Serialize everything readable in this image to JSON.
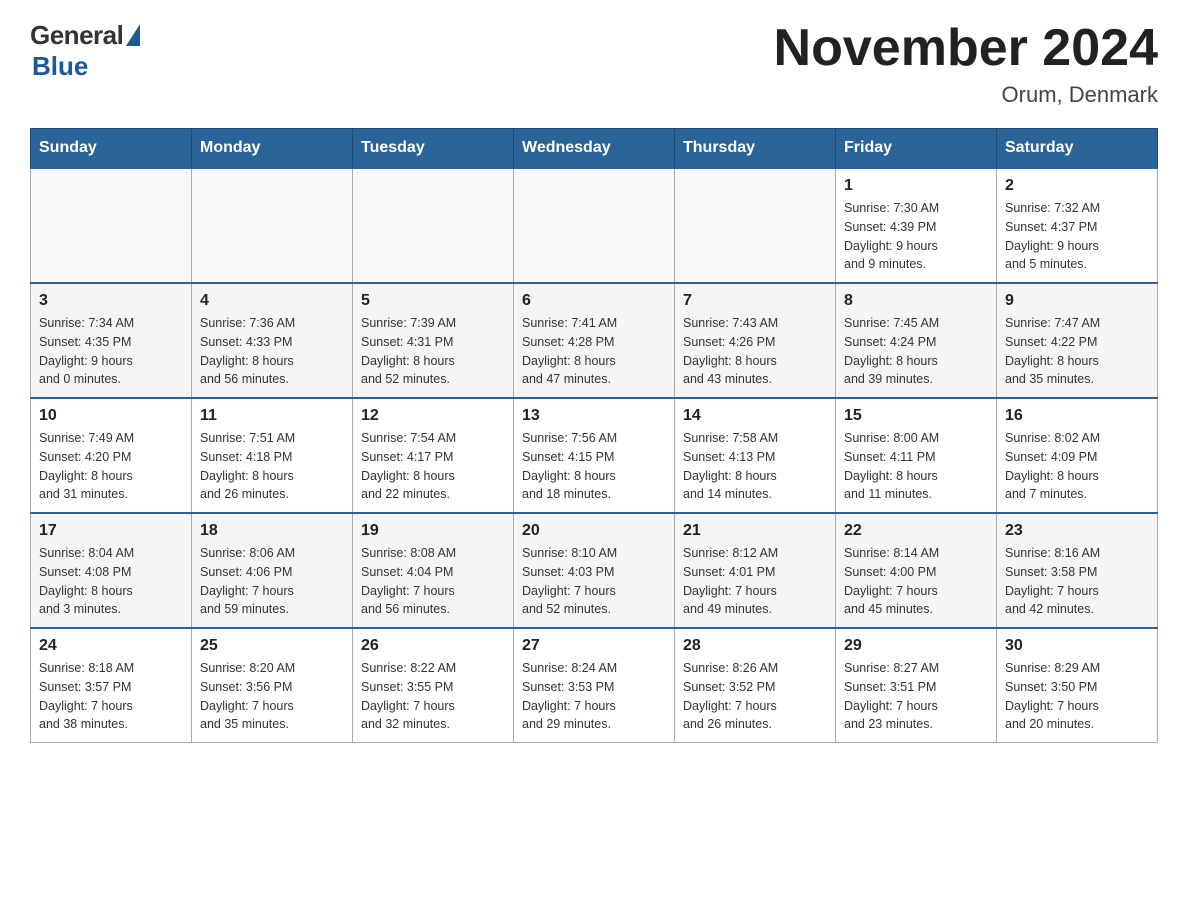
{
  "header": {
    "logo": {
      "general": "General",
      "blue": "Blue"
    },
    "title": "November 2024",
    "location": "Orum, Denmark"
  },
  "weekdays": [
    "Sunday",
    "Monday",
    "Tuesday",
    "Wednesday",
    "Thursday",
    "Friday",
    "Saturday"
  ],
  "weeks": [
    {
      "days": [
        {
          "num": "",
          "info": ""
        },
        {
          "num": "",
          "info": ""
        },
        {
          "num": "",
          "info": ""
        },
        {
          "num": "",
          "info": ""
        },
        {
          "num": "",
          "info": ""
        },
        {
          "num": "1",
          "info": "Sunrise: 7:30 AM\nSunset: 4:39 PM\nDaylight: 9 hours\nand 9 minutes."
        },
        {
          "num": "2",
          "info": "Sunrise: 7:32 AM\nSunset: 4:37 PM\nDaylight: 9 hours\nand 5 minutes."
        }
      ]
    },
    {
      "days": [
        {
          "num": "3",
          "info": "Sunrise: 7:34 AM\nSunset: 4:35 PM\nDaylight: 9 hours\nand 0 minutes."
        },
        {
          "num": "4",
          "info": "Sunrise: 7:36 AM\nSunset: 4:33 PM\nDaylight: 8 hours\nand 56 minutes."
        },
        {
          "num": "5",
          "info": "Sunrise: 7:39 AM\nSunset: 4:31 PM\nDaylight: 8 hours\nand 52 minutes."
        },
        {
          "num": "6",
          "info": "Sunrise: 7:41 AM\nSunset: 4:28 PM\nDaylight: 8 hours\nand 47 minutes."
        },
        {
          "num": "7",
          "info": "Sunrise: 7:43 AM\nSunset: 4:26 PM\nDaylight: 8 hours\nand 43 minutes."
        },
        {
          "num": "8",
          "info": "Sunrise: 7:45 AM\nSunset: 4:24 PM\nDaylight: 8 hours\nand 39 minutes."
        },
        {
          "num": "9",
          "info": "Sunrise: 7:47 AM\nSunset: 4:22 PM\nDaylight: 8 hours\nand 35 minutes."
        }
      ]
    },
    {
      "days": [
        {
          "num": "10",
          "info": "Sunrise: 7:49 AM\nSunset: 4:20 PM\nDaylight: 8 hours\nand 31 minutes."
        },
        {
          "num": "11",
          "info": "Sunrise: 7:51 AM\nSunset: 4:18 PM\nDaylight: 8 hours\nand 26 minutes."
        },
        {
          "num": "12",
          "info": "Sunrise: 7:54 AM\nSunset: 4:17 PM\nDaylight: 8 hours\nand 22 minutes."
        },
        {
          "num": "13",
          "info": "Sunrise: 7:56 AM\nSunset: 4:15 PM\nDaylight: 8 hours\nand 18 minutes."
        },
        {
          "num": "14",
          "info": "Sunrise: 7:58 AM\nSunset: 4:13 PM\nDaylight: 8 hours\nand 14 minutes."
        },
        {
          "num": "15",
          "info": "Sunrise: 8:00 AM\nSunset: 4:11 PM\nDaylight: 8 hours\nand 11 minutes."
        },
        {
          "num": "16",
          "info": "Sunrise: 8:02 AM\nSunset: 4:09 PM\nDaylight: 8 hours\nand 7 minutes."
        }
      ]
    },
    {
      "days": [
        {
          "num": "17",
          "info": "Sunrise: 8:04 AM\nSunset: 4:08 PM\nDaylight: 8 hours\nand 3 minutes."
        },
        {
          "num": "18",
          "info": "Sunrise: 8:06 AM\nSunset: 4:06 PM\nDaylight: 7 hours\nand 59 minutes."
        },
        {
          "num": "19",
          "info": "Sunrise: 8:08 AM\nSunset: 4:04 PM\nDaylight: 7 hours\nand 56 minutes."
        },
        {
          "num": "20",
          "info": "Sunrise: 8:10 AM\nSunset: 4:03 PM\nDaylight: 7 hours\nand 52 minutes."
        },
        {
          "num": "21",
          "info": "Sunrise: 8:12 AM\nSunset: 4:01 PM\nDaylight: 7 hours\nand 49 minutes."
        },
        {
          "num": "22",
          "info": "Sunrise: 8:14 AM\nSunset: 4:00 PM\nDaylight: 7 hours\nand 45 minutes."
        },
        {
          "num": "23",
          "info": "Sunrise: 8:16 AM\nSunset: 3:58 PM\nDaylight: 7 hours\nand 42 minutes."
        }
      ]
    },
    {
      "days": [
        {
          "num": "24",
          "info": "Sunrise: 8:18 AM\nSunset: 3:57 PM\nDaylight: 7 hours\nand 38 minutes."
        },
        {
          "num": "25",
          "info": "Sunrise: 8:20 AM\nSunset: 3:56 PM\nDaylight: 7 hours\nand 35 minutes."
        },
        {
          "num": "26",
          "info": "Sunrise: 8:22 AM\nSunset: 3:55 PM\nDaylight: 7 hours\nand 32 minutes."
        },
        {
          "num": "27",
          "info": "Sunrise: 8:24 AM\nSunset: 3:53 PM\nDaylight: 7 hours\nand 29 minutes."
        },
        {
          "num": "28",
          "info": "Sunrise: 8:26 AM\nSunset: 3:52 PM\nDaylight: 7 hours\nand 26 minutes."
        },
        {
          "num": "29",
          "info": "Sunrise: 8:27 AM\nSunset: 3:51 PM\nDaylight: 7 hours\nand 23 minutes."
        },
        {
          "num": "30",
          "info": "Sunrise: 8:29 AM\nSunset: 3:50 PM\nDaylight: 7 hours\nand 20 minutes."
        }
      ]
    }
  ]
}
